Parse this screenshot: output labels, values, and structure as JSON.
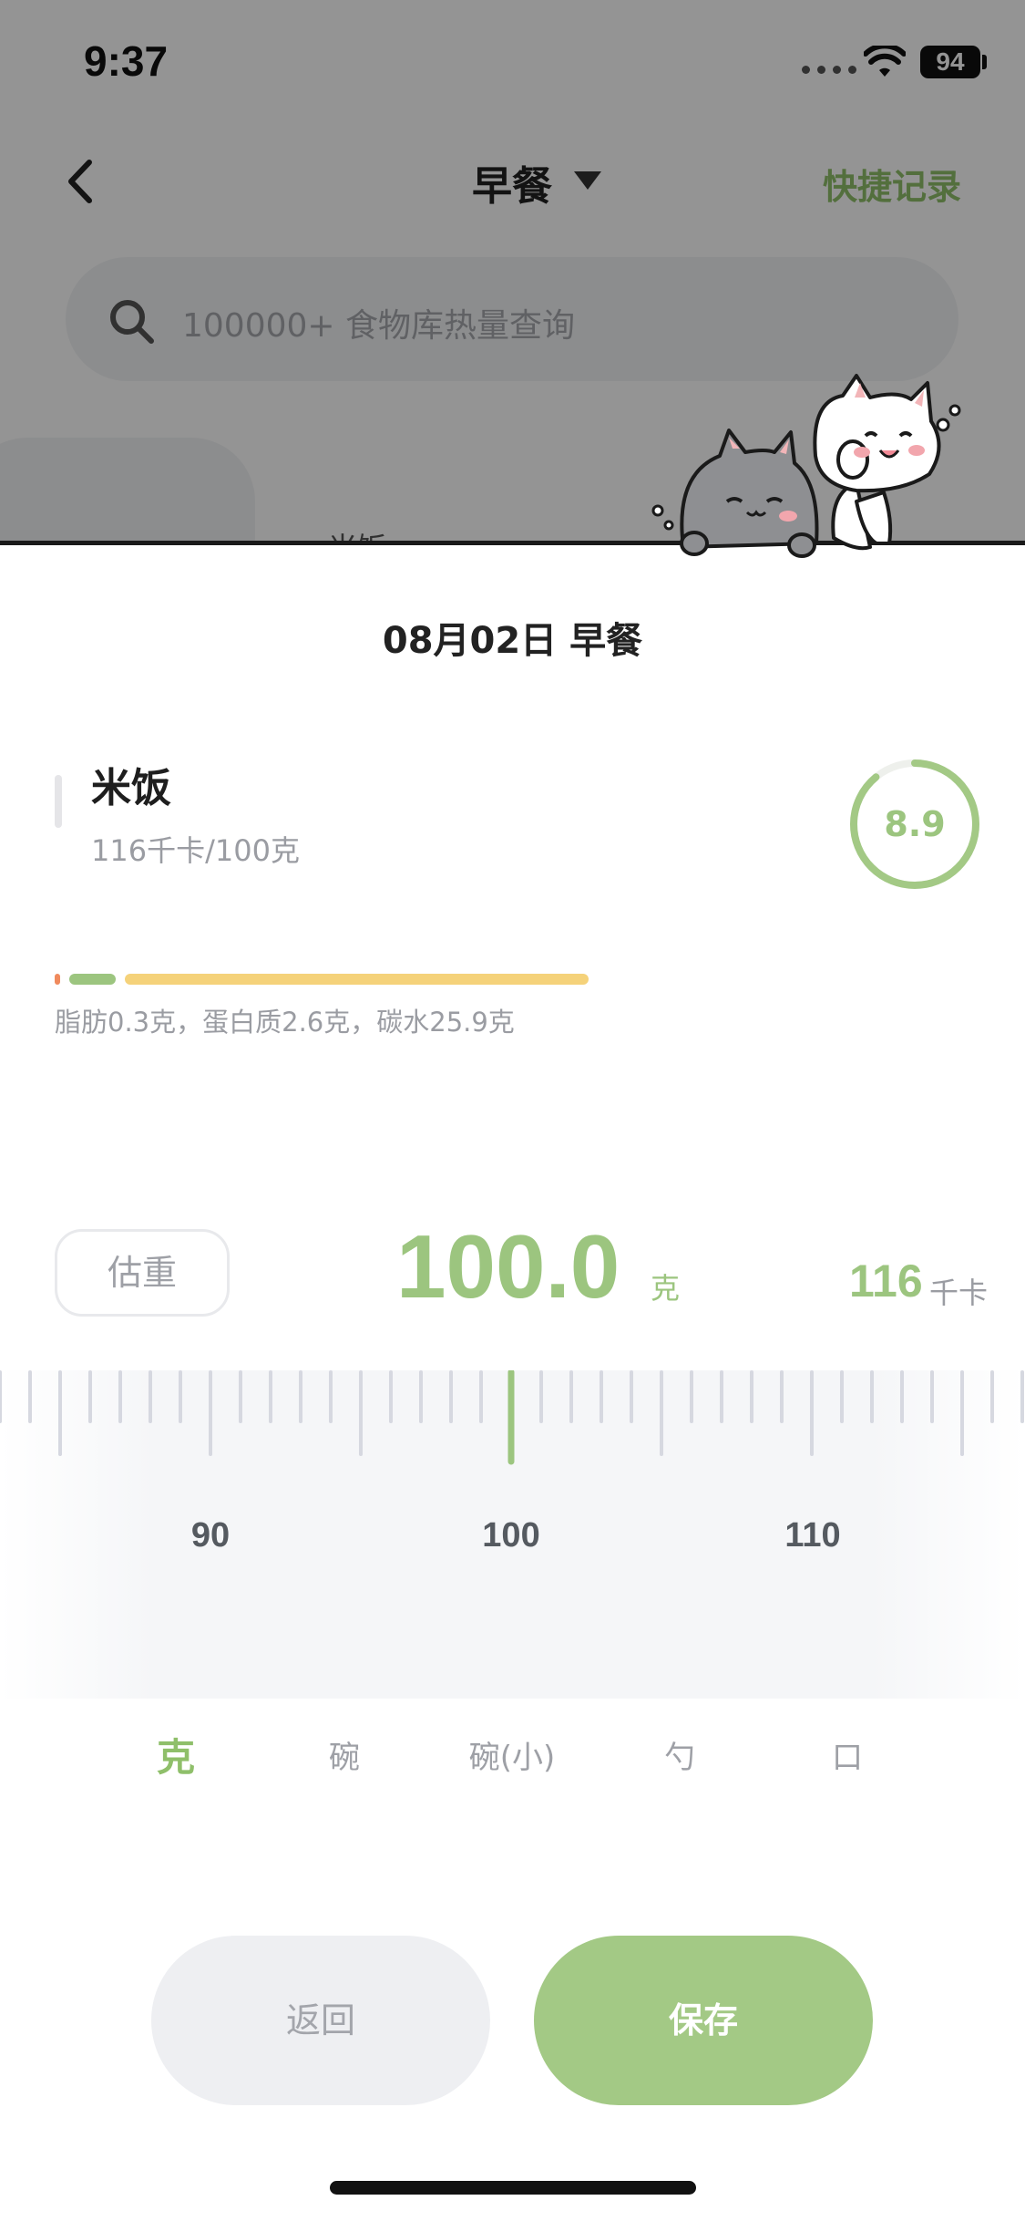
{
  "status_bar": {
    "time": "9:37",
    "battery": "94"
  },
  "nav": {
    "title": "早餐",
    "quick_record": "快捷记录"
  },
  "search": {
    "placeholder": "100000+ 食物库热量查询"
  },
  "background": {
    "peek_text": "米饭"
  },
  "sheet": {
    "title": "08月02日 早餐",
    "food": {
      "name": "米饭",
      "kcal_per_100g": "116千卡/100克",
      "score": "8.9",
      "score_fraction": 0.89
    },
    "macros": {
      "text": "脂肪0.3克，蛋白质2.6克，碳水25.9克",
      "fat_g": 0.3,
      "protein_g": 2.6,
      "carbs_g": 25.9,
      "colors": {
        "fat": "#f08a5d",
        "protein": "#9cc57f",
        "carbs": "#f5d27a"
      }
    },
    "estimate_label": "估重",
    "weight": {
      "value": "100.0",
      "unit": "克"
    },
    "calories": {
      "value": "116",
      "unit": "千卡"
    },
    "ruler": {
      "labels": [
        "90",
        "100",
        "110"
      ],
      "selected": 100
    },
    "units": [
      {
        "label": "克",
        "active": true
      },
      {
        "label": "碗",
        "active": false
      },
      {
        "label": "碗(小)",
        "active": false
      },
      {
        "label": "勺",
        "active": false
      },
      {
        "label": "口",
        "active": false
      }
    ],
    "back_label": "返回",
    "save_label": "保存"
  },
  "colors": {
    "accent": "#9cc57f",
    "save_button": "#a3c985",
    "back_button": "#eeeff2"
  }
}
